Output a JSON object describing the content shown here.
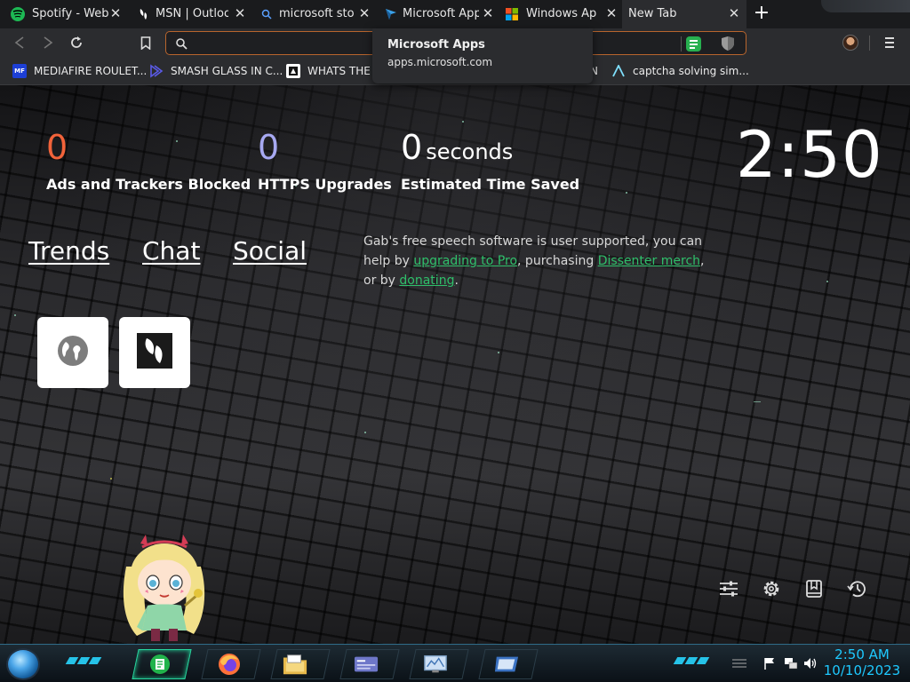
{
  "tabs": [
    {
      "title": "Spotify - Web P",
      "icon": "spotify-icon",
      "active": false
    },
    {
      "title": "MSN | Outlook,",
      "icon": "butterfly-icon",
      "active": false
    },
    {
      "title": "microsoft store",
      "icon": "search-icon",
      "active": false
    },
    {
      "title": "Microsoft Apps",
      "icon": "microsoft-apps-icon",
      "active": false
    },
    {
      "title": "Windows Apps",
      "icon": "windows-logo-icon",
      "active": false
    },
    {
      "title": "New Tab",
      "icon": "",
      "active": true
    }
  ],
  "new_tab_label": "+",
  "tooltip": {
    "title": "Microsoft Apps",
    "url": "apps.microsoft.com"
  },
  "address": {
    "value": "",
    "placeholder": ""
  },
  "bookmarks": [
    {
      "label": "MEDIAFIRE ROULET...",
      "icon": "mediafire-icon"
    },
    {
      "label": "SMASH GLASS IN C...",
      "icon": "smash-glass-icon"
    },
    {
      "label": "WHATS THE F",
      "icon": "whats-icon"
    },
    {
      "label": "N",
      "icon": ""
    },
    {
      "label": "captcha solving sim...",
      "icon": "captcha-icon"
    }
  ],
  "stats": {
    "ads_blocked": {
      "value": "0",
      "label": "Ads and Trackers Blocked"
    },
    "https_upgrades": {
      "value": "0",
      "label": "HTTPS Upgrades"
    },
    "time_saved": {
      "value": "0",
      "unit": "seconds",
      "label": "Estimated Time Saved"
    }
  },
  "clock": "2:50",
  "nav_links": [
    "Trends",
    "Chat",
    "Social"
  ],
  "gab": {
    "text1": "Gab's free speech software is user supported, you can help by ",
    "link1": "upgrading to Pro",
    "text2": ", purchasing ",
    "link2": "Dissenter merch",
    "text3": ", or by ",
    "link3": "donating",
    "text4": "."
  },
  "tiles": [
    {
      "name": "globe-tile",
      "icon": "globe-icon"
    },
    {
      "name": "butterfly-tile",
      "icon": "butterfly-icon"
    }
  ],
  "bottom_icons": [
    "customize-icon",
    "settings-icon",
    "bookmarks-icon",
    "history-icon"
  ],
  "taskbar": {
    "apps": [
      "notes-app-icon",
      "firefox-icon",
      "file-explorer-icon",
      "card-app-icon",
      "monitor-app-icon",
      "window-app-icon"
    ],
    "time": "2:50 AM",
    "date": "10/10/2023"
  },
  "colors": {
    "accent_orange": "#f2633a",
    "accent_purple": "#a7a9f2",
    "link_green": "#2fbf6a",
    "url_border": "#b8652d",
    "clock_cyan": "#1ec9ff"
  }
}
